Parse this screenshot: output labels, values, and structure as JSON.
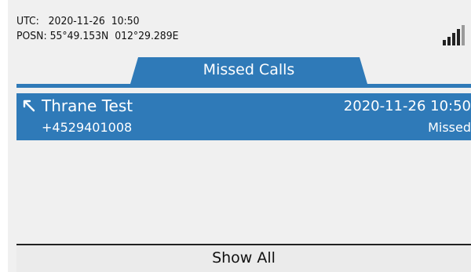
{
  "status": {
    "utc": "UTC:   2020-11-26  10:50",
    "position": "POSN: 55°49.153N  012°29.289E",
    "signal_icon": "signal-strength-icon"
  },
  "tab": {
    "label": "Missed Calls"
  },
  "calls": [
    {
      "name": "Thrane Test",
      "number": "+4529401008",
      "time": "2020-11-26 10:50",
      "status": "Missed",
      "icon": "missed-call-icon"
    }
  ],
  "footer": {
    "show_all_label": "Show All"
  },
  "colors": {
    "accent": "#2f7ab8",
    "background": "#f0f0f0",
    "text": "#111111",
    "selected_text": "#ffffff"
  }
}
